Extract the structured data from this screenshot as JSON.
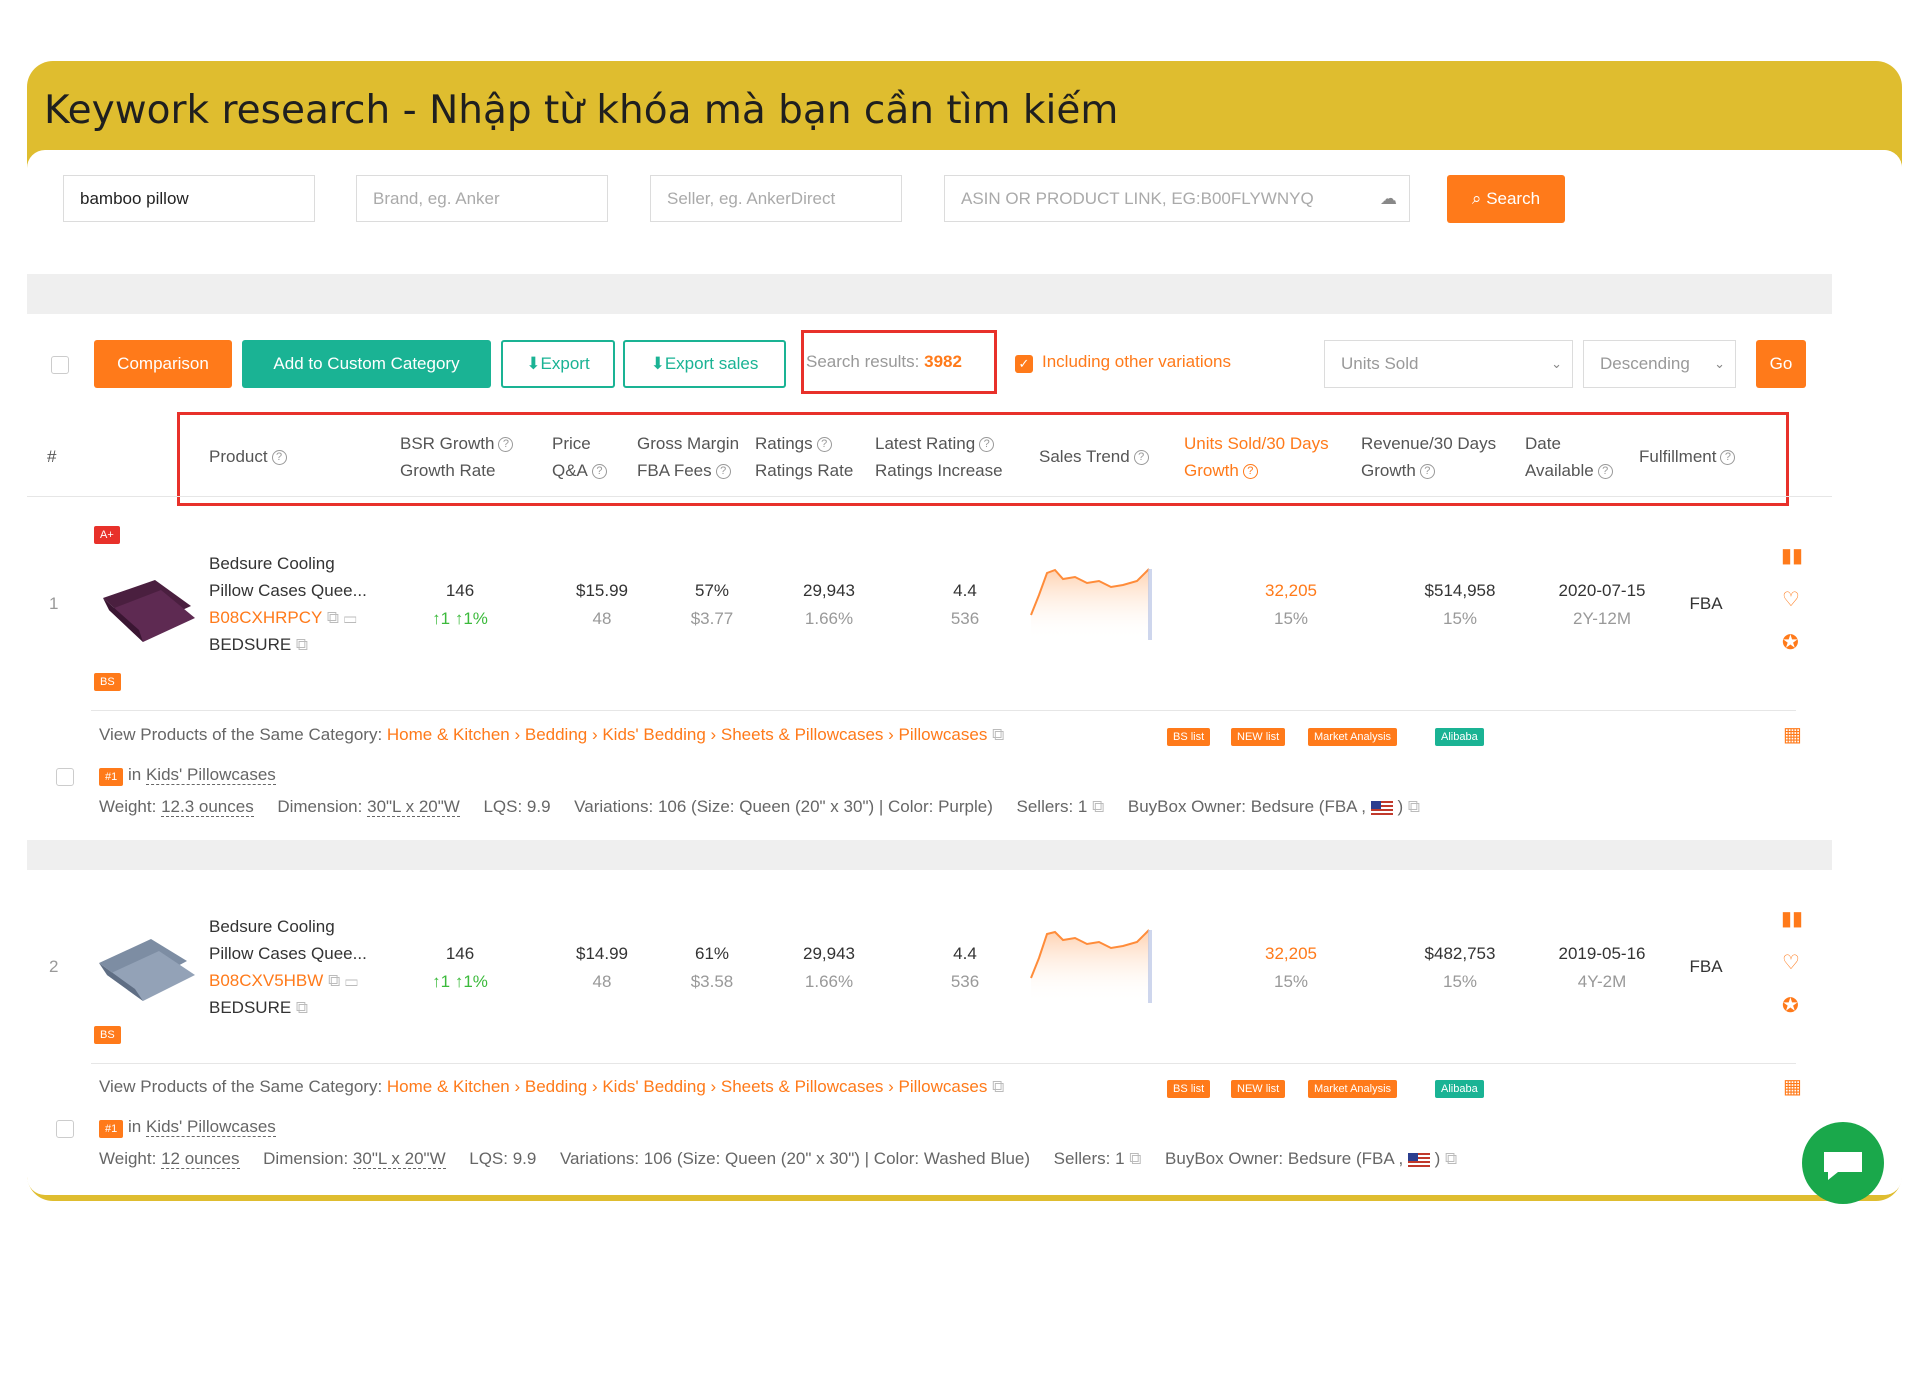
{
  "banner_title": "Keywork research - Nhập từ khóa mà bạn cần tìm kiếm",
  "search": {
    "keyword_value": "bamboo pillow",
    "brand_placeholder": "Brand, eg. Anker",
    "seller_placeholder": "Seller, eg. AnkerDirect",
    "asin_placeholder": "ASIN OR PRODUCT LINK, EG:B00FLYWNYQ",
    "search_label": "Search"
  },
  "toolbar": {
    "comparison": "Comparison",
    "add_custom": "Add to Custom Category",
    "export": "Export",
    "export_sales": "Export sales",
    "results_label": "Search results:",
    "results_count": "3982",
    "variations_label": "Including other variations",
    "sort_field": "Units Sold",
    "sort_order": "Descending",
    "go": "Go"
  },
  "headers": {
    "index": "#",
    "product": "Product",
    "bsr_growth": "BSR Growth",
    "growth_rate": "Growth Rate",
    "price": "Price",
    "qa": "Q&A",
    "gross_margin": "Gross Margin",
    "fba_fees": "FBA Fees",
    "ratings": "Ratings",
    "ratings_rate": "Ratings Rate",
    "latest_rating": "Latest Rating",
    "ratings_increase": "Ratings Increase",
    "sales_trend": "Sales Trend",
    "units_sold": "Units Sold/30 Days",
    "units_growth": "Growth",
    "revenue": "Revenue/30 Days",
    "revenue_growth": "Growth",
    "date": "Date",
    "available": "Available",
    "fulfillment": "Fulfillment"
  },
  "category_label": "View Products of the Same Category:",
  "category_path": "Home & Kitchen › Bedding › Kids' Bedding › Sheets & Pillowcases › Pillowcases",
  "tags": {
    "bs_list": "BS list",
    "new_list": "NEW list",
    "market": "Market Analysis",
    "alibaba": "Alibaba"
  },
  "rank_badge": "#1",
  "rank_in": "in",
  "rank_category": "Kids' Pillowcases",
  "labels": {
    "weight": "Weight:",
    "dimension": "Dimension:",
    "lqs": "LQS: 9.9",
    "sellers": "Sellers: 1",
    "buybox": "BuyBox Owner:",
    "aplus": "A+",
    "bs": "BS"
  },
  "products": [
    {
      "index": "1",
      "title1": "Bedsure Cooling",
      "title2": "Pillow Cases Quee...",
      "asin": "B08CXHRPCY",
      "brand": "BEDSURE",
      "bsr": "146",
      "bsr_growth1": "1",
      "bsr_growth2": "1%",
      "price": "$15.99",
      "qa": "48",
      "margin": "57%",
      "fba": "$3.77",
      "ratings": "29,943",
      "ratings_rate": "1.66%",
      "latest": "4.4",
      "increase": "536",
      "units": "32,205",
      "units_growth": "15%",
      "revenue": "$514,958",
      "revenue_growth": "15%",
      "date": "2020-07-15",
      "age": "2Y-12M",
      "fulfillment": "FBA",
      "weight": "12.3 ounces",
      "dimension": "30\"L x 20\"W",
      "variations": "Variations: 106 (Size: Queen (20\" x 30\") | Color: Purple)",
      "buybox_owner": "Bedsure",
      "buybox_type": "(FBA ,",
      "color": "#4a1f3f"
    },
    {
      "index": "2",
      "title1": "Bedsure Cooling",
      "title2": "Pillow Cases Quee...",
      "asin": "B08CXV5HBW",
      "brand": "BEDSURE",
      "bsr": "146",
      "bsr_growth1": "1",
      "bsr_growth2": "1%",
      "price": "$14.99",
      "qa": "48",
      "margin": "61%",
      "fba": "$3.58",
      "ratings": "29,943",
      "ratings_rate": "1.66%",
      "latest": "4.4",
      "increase": "536",
      "units": "32,205",
      "units_growth": "15%",
      "revenue": "$482,753",
      "revenue_growth": "15%",
      "date": "2019-05-16",
      "age": "4Y-2M",
      "fulfillment": "FBA",
      "weight": "12 ounces",
      "dimension": "30\"L x 20\"W",
      "variations": "Variations: 106 (Size: Queen (20\" x 30\") | Color: Washed Blue)",
      "buybox_owner": "Bedsure",
      "buybox_type": "(FBA ,",
      "color": "#7d8da3"
    }
  ],
  "colors": {
    "accent": "#ff7a1a",
    "teal": "#1ab394",
    "frame": "#dfbd2f",
    "highlight": "#e8312a"
  }
}
